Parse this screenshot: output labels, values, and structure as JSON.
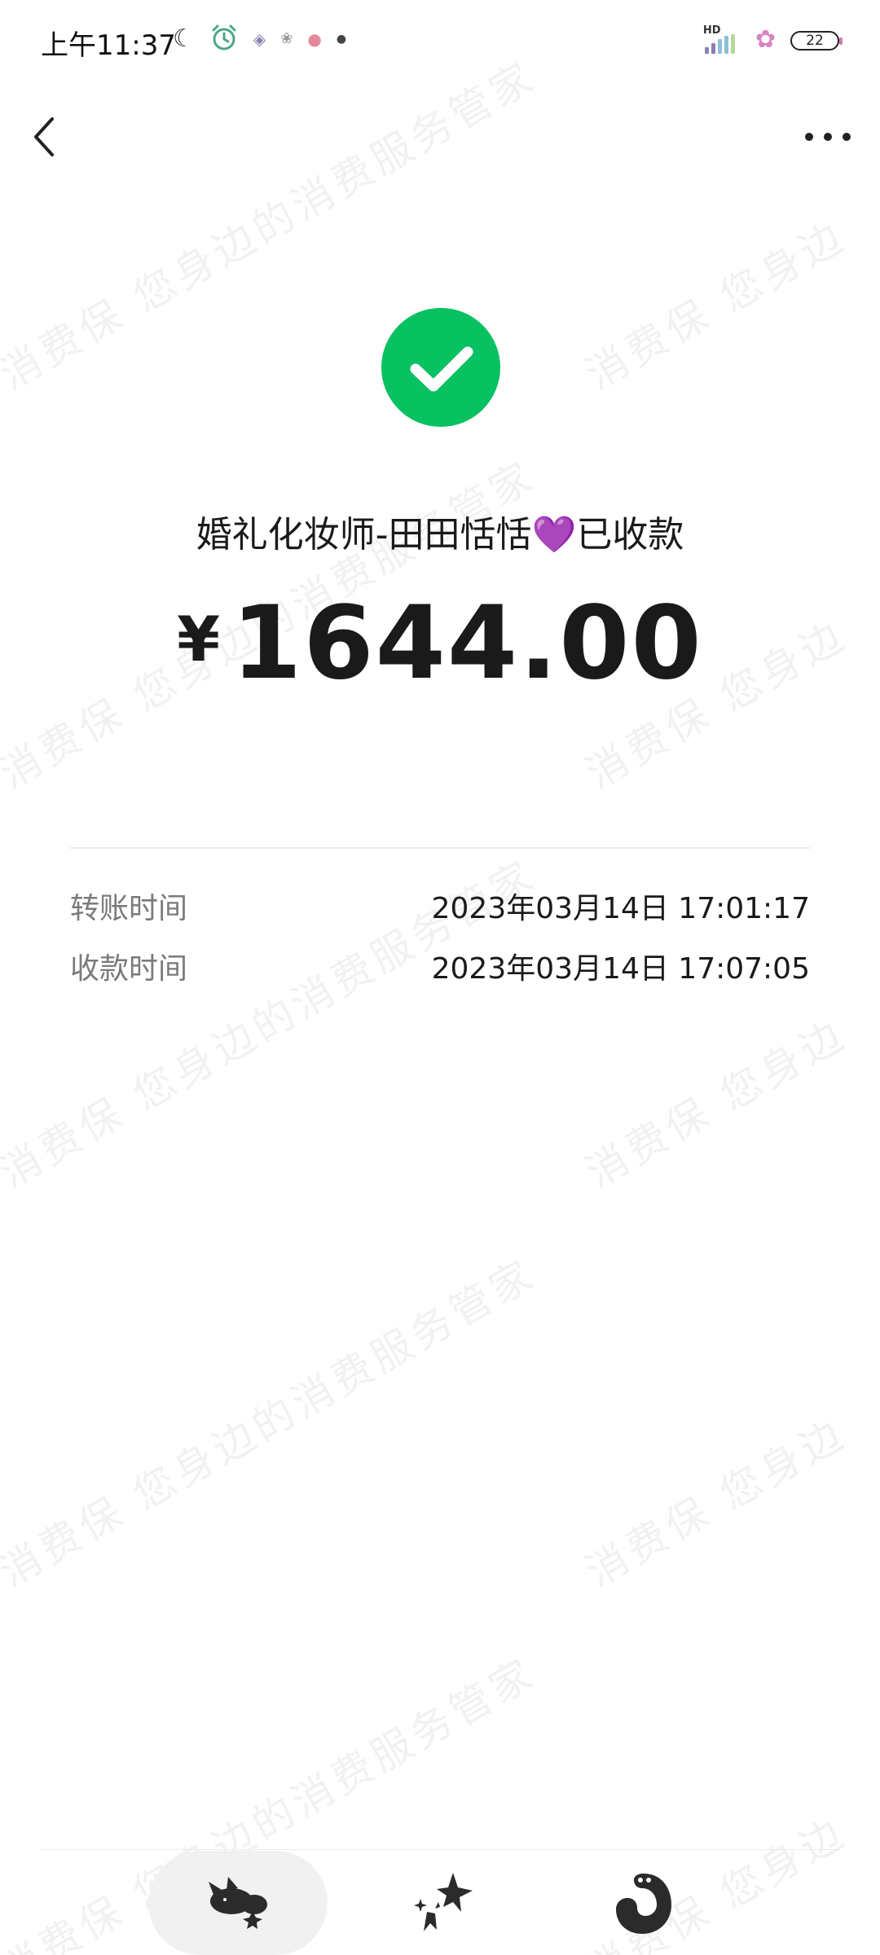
{
  "status_bar": {
    "time": "上午11:37",
    "left_icons": [
      "moon-icon",
      "alarm-icon",
      "app-notification-icon",
      "app-notification-icon",
      "app-notification-icon",
      "dot-icon"
    ],
    "network_label": "HD",
    "battery_level": "22"
  },
  "nav": {
    "back_icon": "chevron-left-icon",
    "more_icon": "more-dots-icon"
  },
  "result": {
    "status_icon": "check-circle-icon",
    "status_color": "#08C160",
    "payee": "婚礼化妆师-田田恬恬",
    "payee_emoji": "💜",
    "status_text": "已收款",
    "currency_symbol": "¥",
    "amount": "1644.00"
  },
  "details": [
    {
      "label": "转账时间",
      "value": "2023年03月14日 17:01:17"
    },
    {
      "label": "收款时间",
      "value": "2023年03月14日 17:07:05"
    }
  ],
  "watermark": {
    "line_a": "消费保 您身边的消费服务管家",
    "line_b": "消费保 您身边"
  },
  "bottom_nav": {
    "tabs": [
      "cat-sticker-icon",
      "magic-wand-icon",
      "snake-sticker-icon"
    ]
  }
}
